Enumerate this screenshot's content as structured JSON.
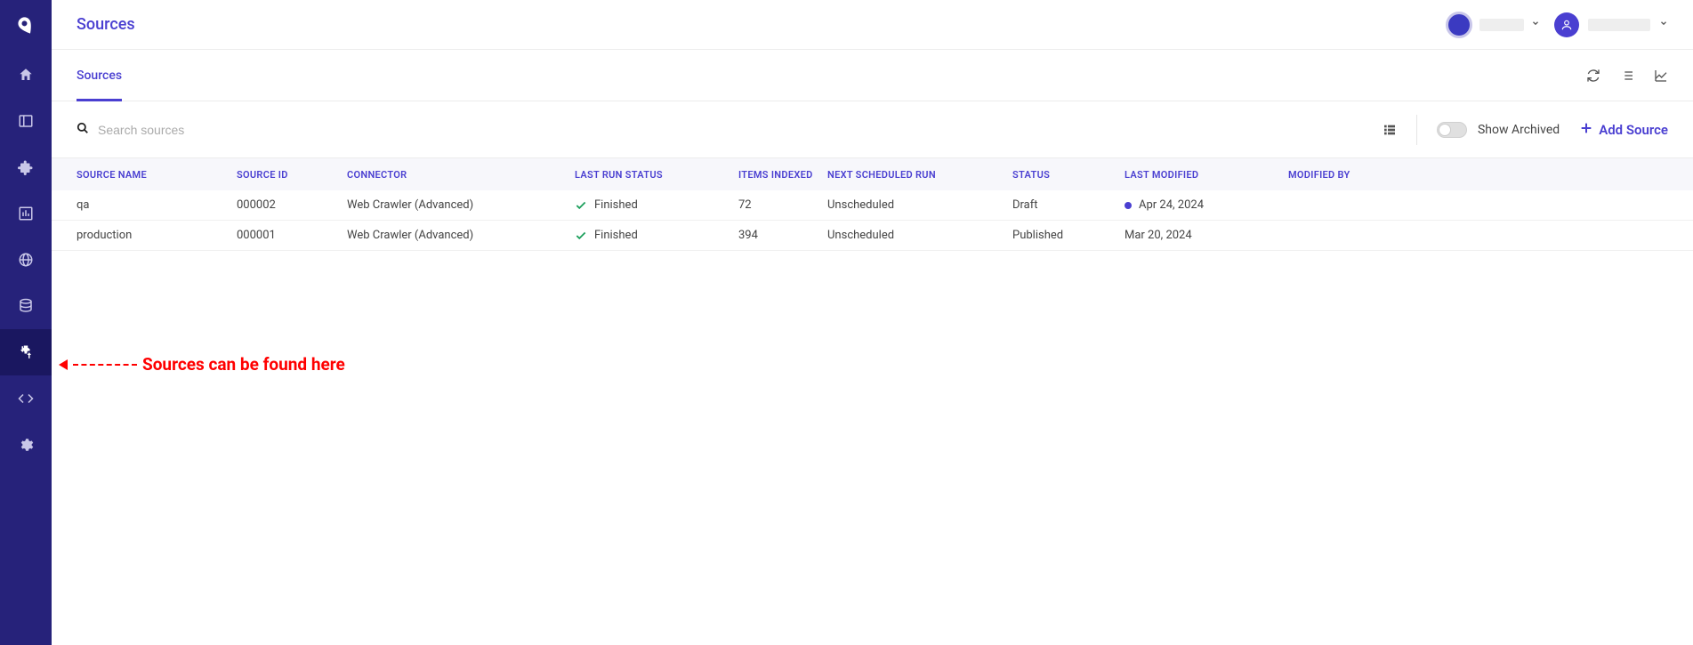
{
  "header": {
    "title": "Sources"
  },
  "tabs": {
    "sources": "Sources"
  },
  "toolbar": {
    "search_placeholder": "Search sources",
    "show_archived_label": "Show Archived",
    "add_source_label": "Add Source"
  },
  "table": {
    "headers": {
      "source_name": "SOURCE NAME",
      "source_id": "SOURCE ID",
      "connector": "CONNECTOR",
      "last_run_status": "LAST RUN STATUS",
      "items_indexed": "ITEMS INDEXED",
      "next_scheduled_run": "NEXT SCHEDULED RUN",
      "status": "STATUS",
      "last_modified": "LAST MODIFIED",
      "modified_by": "MODIFIED BY"
    },
    "rows": [
      {
        "source_name": "qa",
        "source_id": "000002",
        "connector": "Web Crawler (Advanced)",
        "last_run_status": "Finished",
        "items_indexed": "72",
        "next_scheduled_run": "Unscheduled",
        "status": "Draft",
        "last_modified": "Apr 24, 2024",
        "last_modified_has_dot": true,
        "modified_by": ""
      },
      {
        "source_name": "production",
        "source_id": "000001",
        "connector": "Web Crawler (Advanced)",
        "last_run_status": "Finished",
        "items_indexed": "394",
        "next_scheduled_run": "Unscheduled",
        "status": "Published",
        "last_modified": "Mar 20, 2024",
        "last_modified_has_dot": false,
        "modified_by": ""
      }
    ]
  },
  "annotation": {
    "text": "Sources can be found here"
  },
  "colors": {
    "primary": "#4a3fd1",
    "sidebar_bg": "#26227a",
    "success": "#1a9e5a",
    "annotation": "#ff0000"
  }
}
